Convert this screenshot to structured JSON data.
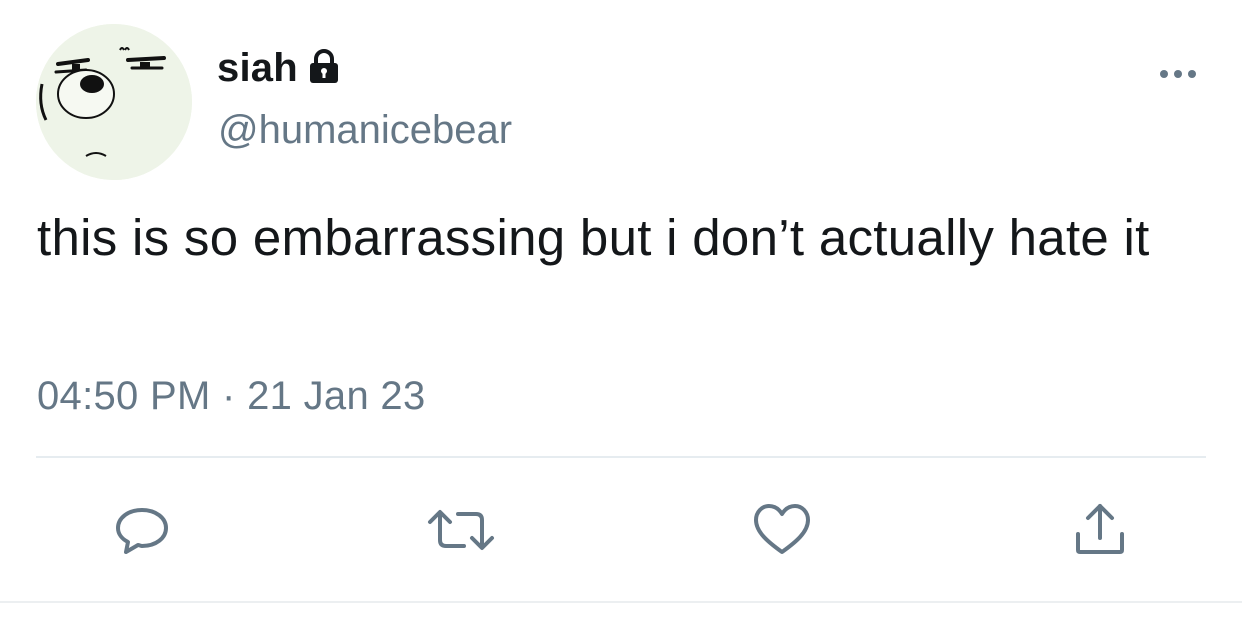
{
  "tweet": {
    "display_name": "siah",
    "handle": "@humanicebear",
    "text": "this is so embarrassing but i don’t actually hate it",
    "time": "04:50 PM",
    "separator": "·",
    "date": "21 Jan 23",
    "protected": true
  },
  "icons": {
    "avatar": "bear-face-avatar",
    "lock": "lock-icon",
    "more": "more-options-icon",
    "reply": "reply-icon",
    "retweet": "retweet-icon",
    "like": "like-icon",
    "share": "share-icon"
  },
  "colors": {
    "text_primary": "#14171a",
    "text_secondary": "#657786",
    "icon": "#657786",
    "divider": "#e6ecf0"
  }
}
